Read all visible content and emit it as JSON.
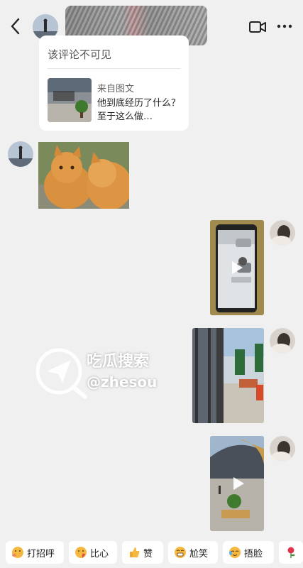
{
  "card": {
    "hidden_notice": "该评论不可见",
    "source": "来自图文",
    "title": "他到底经历了什么？至于这么做…"
  },
  "watermark": {
    "line1": "吃瓜搜索",
    "line2": "@zhesou"
  },
  "quick_replies": [
    {
      "label": "打招呼",
      "icon": "wave-emoji"
    },
    {
      "label": "比心",
      "icon": "heart-hands-emoji"
    },
    {
      "label": "赞",
      "icon": "thumbs-up-emoji"
    },
    {
      "label": "尬笑",
      "icon": "awkward-smile-emoji"
    },
    {
      "label": "捂脸",
      "icon": "facepalm-emoji"
    },
    {
      "label": "",
      "icon": "rose-emoji"
    }
  ],
  "colors": {
    "background": "#f0f0f0",
    "bubble": "#ffffff",
    "emoji": "#f5b942"
  }
}
